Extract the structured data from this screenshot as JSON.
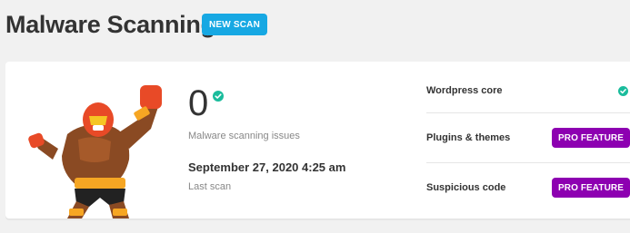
{
  "header": {
    "title": "Malware Scanning",
    "new_scan_label": "NEW SCAN"
  },
  "summary": {
    "issue_count": "0",
    "issue_label": "Malware scanning issues",
    "last_scan_date": "September 27, 2020 4:25 am",
    "last_scan_label": "Last scan"
  },
  "checks": [
    {
      "label": "Wordpress core",
      "status": "ok"
    },
    {
      "label": "Plugins & themes",
      "status": "pro",
      "button_label": "PRO FEATURE"
    },
    {
      "label": "Suspicious code",
      "status": "pro",
      "button_label": "PRO FEATURE"
    }
  ],
  "colors": {
    "accent_blue": "#17a8e3",
    "success_green": "#1abc9c",
    "pro_purple": "#8d00b1"
  }
}
